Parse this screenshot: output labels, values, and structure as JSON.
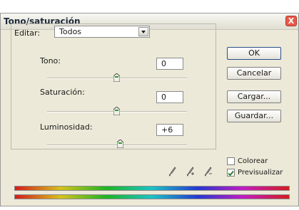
{
  "dialog": {
    "title": "Tono/saturación",
    "close_label": "X"
  },
  "edit": {
    "label": "Editar:",
    "selected": "Todos"
  },
  "sliders": [
    {
      "label": "Tono:",
      "value": "0",
      "range": [
        -180,
        180
      ],
      "level": 0
    },
    {
      "label": "Saturación:",
      "value": "0",
      "range": [
        -100,
        100
      ],
      "level": 0
    },
    {
      "label": "Luminosidad:",
      "value": "+6",
      "range": [
        -100,
        100
      ],
      "level": 6
    }
  ],
  "buttons": {
    "ok": "OK",
    "cancel": "Cancelar",
    "load": "Cargar...",
    "save": "Guardar..."
  },
  "options": {
    "colorize": {
      "label": "Colorear",
      "checked": false
    },
    "preview": {
      "label": "Previsualizar",
      "checked": true
    }
  },
  "icons": {
    "eyedropper": "eyedropper-icon",
    "eyedropper_add": "eyedropper-plus-icon",
    "eyedropper_subtract": "eyedropper-minus-icon"
  }
}
